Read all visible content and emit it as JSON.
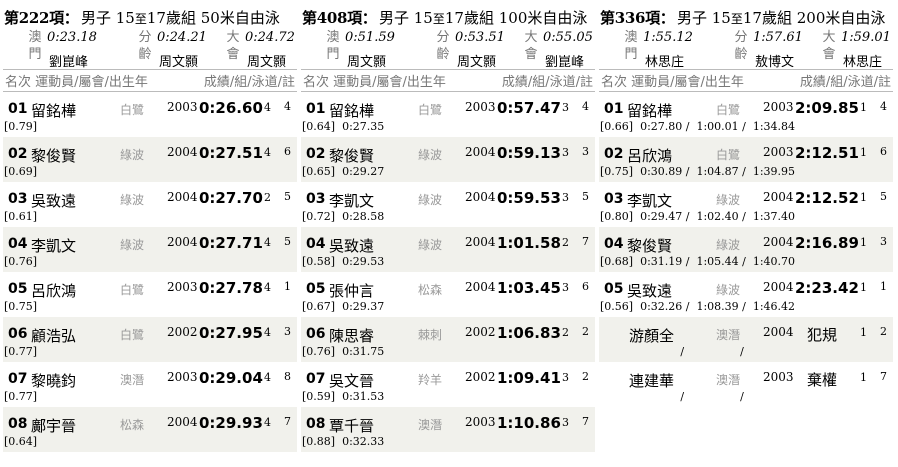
{
  "events": [
    {
      "no": "第222項：",
      "title_pre": "男子 15",
      "title_to": "至",
      "title_post": "17歲組 50米自由泳",
      "records": [
        {
          "label": "澳門",
          "time": "0:23.18",
          "holder": "劉崑峰"
        },
        {
          "label": "分齡",
          "time": "0:24.21",
          "holder": "周文顥"
        },
        {
          "label": "大會",
          "time": "0:24.72",
          "holder": "周文顥"
        }
      ],
      "headers": {
        "left": "名次 運動員/屬會/出生年",
        "right": "成績/組/泳道/註"
      },
      "rows": [
        {
          "rank": "01",
          "name": "留銘樺",
          "club": "白鷺",
          "year": "2003",
          "result": "0:26.60",
          "group": "4",
          "lane": "4",
          "splits": "[0.79]"
        },
        {
          "rank": "02",
          "name": "黎俊賢",
          "club": "綠波",
          "year": "2004",
          "result": "0:27.51",
          "group": "4",
          "lane": "6",
          "splits": "[0.69]"
        },
        {
          "rank": "03",
          "name": "吳致遠",
          "club": "綠波",
          "year": "2004",
          "result": "0:27.70",
          "group": "2",
          "lane": "5",
          "splits": "[0.61]"
        },
        {
          "rank": "04",
          "name": "李凱文",
          "club": "綠波",
          "year": "2004",
          "result": "0:27.71",
          "group": "4",
          "lane": "5",
          "splits": "[0.76]"
        },
        {
          "rank": "05",
          "name": "呂欣鴻",
          "club": "白鷺",
          "year": "2003",
          "result": "0:27.78",
          "group": "4",
          "lane": "1",
          "splits": "[0.75]"
        },
        {
          "rank": "06",
          "name": "顧浩弘",
          "club": "白鷺",
          "year": "2002",
          "result": "0:27.95",
          "group": "4",
          "lane": "3",
          "splits": "[0.77]"
        },
        {
          "rank": "07",
          "name": "黎曉鈞",
          "club": "澳潛",
          "year": "2003",
          "result": "0:29.04",
          "group": "4",
          "lane": "8",
          "splits": "[0.77]"
        },
        {
          "rank": "08",
          "name": "鄺宇晉",
          "club": "松森",
          "year": "2004",
          "result": "0:29.93",
          "group": "4",
          "lane": "7",
          "splits": "[0.64]"
        }
      ]
    },
    {
      "no": "第408項：",
      "title_pre": "男子 15",
      "title_to": "至",
      "title_post": "17歲組 100米自由泳",
      "records": [
        {
          "label": "澳門",
          "time": "0:51.59",
          "holder": "周文顥"
        },
        {
          "label": "分齡",
          "time": "0:53.51",
          "holder": "周文顥"
        },
        {
          "label": "大會",
          "time": "0:55.05",
          "holder": "劉崑峰"
        }
      ],
      "headers": {
        "left": "名次 運動員/屬會/出生年",
        "right": "成績/組/泳道/註"
      },
      "rows": [
        {
          "rank": "01",
          "name": "留銘樺",
          "club": "白鷺",
          "year": "2003",
          "result": "0:57.47",
          "group": "3",
          "lane": "4",
          "splits": "[0.64]  0:27.35"
        },
        {
          "rank": "02",
          "name": "黎俊賢",
          "club": "綠波",
          "year": "2004",
          "result": "0:59.13",
          "group": "3",
          "lane": "3",
          "splits": "[0.65]  0:29.27"
        },
        {
          "rank": "03",
          "name": "李凱文",
          "club": "綠波",
          "year": "2004",
          "result": "0:59.53",
          "group": "3",
          "lane": "5",
          "splits": "[0.72]  0:28.58"
        },
        {
          "rank": "04",
          "name": "吳致遠",
          "club": "綠波",
          "year": "2004",
          "result": "1:01.58",
          "group": "2",
          "lane": "7",
          "splits": "[0.58]  0:29.53"
        },
        {
          "rank": "05",
          "name": "張仲言",
          "club": "松森",
          "year": "2004",
          "result": "1:03.45",
          "group": "3",
          "lane": "6",
          "splits": "[0.67]  0:29.37"
        },
        {
          "rank": "06",
          "name": "陳思睿",
          "club": "棘刺",
          "year": "2002",
          "result": "1:06.83",
          "group": "2",
          "lane": "2",
          "splits": "[0.76]  0:31.75"
        },
        {
          "rank": "07",
          "name": "吳文晉",
          "club": "羚羊",
          "year": "2002",
          "result": "1:09.41",
          "group": "3",
          "lane": "2",
          "splits": "[0.59]  0:31.53"
        },
        {
          "rank": "08",
          "name": "覃千晉",
          "club": "澳潛",
          "year": "2003",
          "result": "1:10.86",
          "group": "3",
          "lane": "7",
          "splits": "[0.88]  0:32.33"
        }
      ]
    },
    {
      "no": "第336項：",
      "title_pre": "男子 15",
      "title_to": "至",
      "title_post": "17歲組 200米自由泳",
      "records": [
        {
          "label": "澳門",
          "time": "1:55.12",
          "holder": "林思庄"
        },
        {
          "label": "分齡",
          "time": "1:57.61",
          "holder": "敖博文"
        },
        {
          "label": "大會",
          "time": "1:59.01",
          "holder": "林思庄"
        }
      ],
      "headers": {
        "left": "名次 運動員/屬會/出生年",
        "right": "成績/組/泳道/註"
      },
      "rows": [
        {
          "rank": "01",
          "name": "留銘樺",
          "club": "白鷺",
          "year": "2003",
          "result": "2:09.85",
          "group": "1",
          "lane": "4",
          "splits": "[0.66]  0:27.80 /  1:00.01 /  1:34.84"
        },
        {
          "rank": "02",
          "name": "呂欣鴻",
          "club": "白鷺",
          "year": "2003",
          "result": "2:12.51",
          "group": "1",
          "lane": "6",
          "splits": "[0.75]  0:30.89 /  1:04.87 /  1:39.95"
        },
        {
          "rank": "03",
          "name": "李凱文",
          "club": "綠波",
          "year": "2004",
          "result": "2:12.52",
          "group": "1",
          "lane": "5",
          "splits": "[0.80]  0:29.47 /  1:02.40 /  1:37.40"
        },
        {
          "rank": "04",
          "name": "黎俊賢",
          "club": "綠波",
          "year": "2004",
          "result": "2:16.89",
          "group": "1",
          "lane": "3",
          "splits": "[0.68]  0:31.19 /  1:05.44 /  1:40.70"
        },
        {
          "rank": "05",
          "name": "吳致遠",
          "club": "綠波",
          "year": "2004",
          "result": "2:23.42",
          "group": "1",
          "lane": "1",
          "splits": "[0.56]  0:32.26 /  1:08.39 /  1:46.42"
        },
        {
          "rank": "",
          "name": "游顏全",
          "club": "澳潛",
          "year": "2004",
          "result": "犯規",
          "group": "1",
          "lane": "2",
          "splits": "                       /                /"
        },
        {
          "rank": "",
          "name": "連建華",
          "club": "澳潛",
          "year": "2003",
          "result": "棄權",
          "group": "1",
          "lane": "7",
          "splits": "                       /                /"
        }
      ]
    }
  ]
}
